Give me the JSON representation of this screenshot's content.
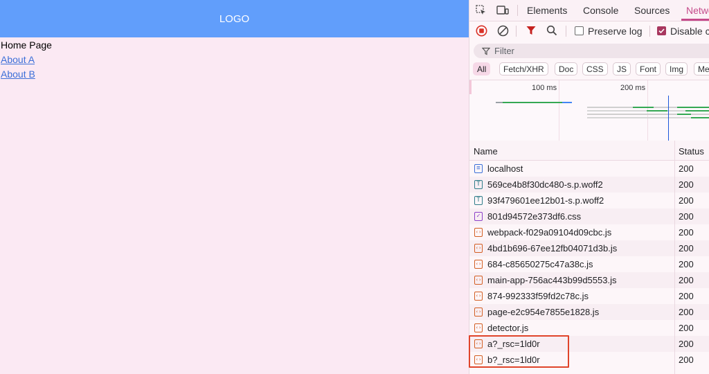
{
  "page": {
    "logo": "LOGO",
    "home_text": "Home Page",
    "links": [
      "About A",
      "About B"
    ]
  },
  "devtools": {
    "tabs": [
      "Elements",
      "Console",
      "Sources",
      "Network"
    ],
    "active_tab": "Network",
    "toolbar": {
      "preserve_log_label": "Preserve log",
      "preserve_log_checked": false,
      "disable_cache_label": "Disable cache",
      "disable_cache_checked": true
    },
    "filter_placeholder": "Filter",
    "type_filters": [
      "All",
      "Fetch/XHR",
      "Doc",
      "CSS",
      "JS",
      "Font",
      "Img",
      "Media"
    ],
    "active_type_filter": "All",
    "timeline_labels": [
      "100 ms",
      "200 ms"
    ],
    "table": {
      "columns": [
        "Name",
        "Status"
      ],
      "rows": [
        {
          "name": "localhost",
          "status": "200",
          "type": "doc"
        },
        {
          "name": "569ce4b8f30dc480-s.p.woff2",
          "status": "200",
          "type": "font"
        },
        {
          "name": "93f479601ee12b01-s.p.woff2",
          "status": "200",
          "type": "font"
        },
        {
          "name": "801d94572e373df6.css",
          "status": "200",
          "type": "css"
        },
        {
          "name": "webpack-f029a09104d09cbc.js",
          "status": "200",
          "type": "js"
        },
        {
          "name": "4bd1b696-67ee12fb04071d3b.js",
          "status": "200",
          "type": "js"
        },
        {
          "name": "684-c85650275c47a38c.js",
          "status": "200",
          "type": "js"
        },
        {
          "name": "main-app-756ac443b99d5553.js",
          "status": "200",
          "type": "js"
        },
        {
          "name": "874-992333f59fd2c78c.js",
          "status": "200",
          "type": "js"
        },
        {
          "name": "page-e2c954e7855e1828.js",
          "status": "200",
          "type": "js"
        },
        {
          "name": "detector.js",
          "status": "200",
          "type": "js"
        },
        {
          "name": "a?_rsc=1ld0r",
          "status": "200",
          "type": "js"
        },
        {
          "name": "b?_rsc=1ld0r",
          "status": "200",
          "type": "js"
        }
      ]
    },
    "highlight_color": "#e0442a",
    "accent_color": "#c54a8a"
  }
}
